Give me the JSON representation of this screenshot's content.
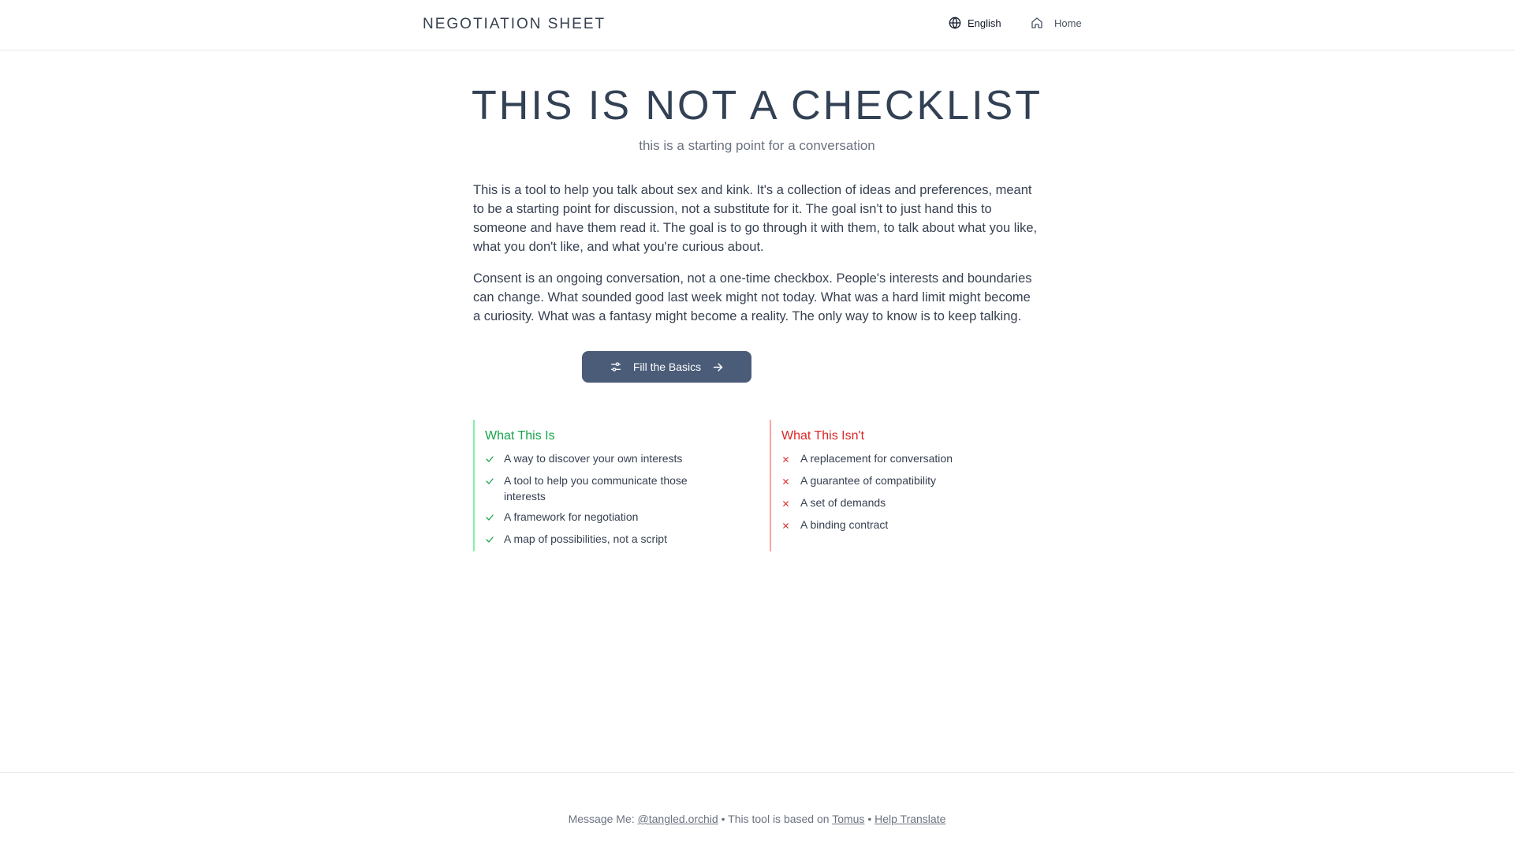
{
  "header": {
    "brand": "NEGOTIATION SHEET",
    "language_label": "English",
    "home_label": "Home"
  },
  "hero": {
    "title": "THIS IS NOT A CHECKLIST",
    "subtitle": "this is a starting point for a conversation"
  },
  "intro": {
    "paragraph_1": "This is a tool to help you talk about sex and kink. It's a collection of ideas and preferences, meant to be a starting point for discussion, not a substitute for it. The goal isn't to just hand this to someone and have them read it. The goal is to go through it with them, to talk about what you like, what you don't like, and what you're curious about.",
    "paragraph_2": "Consent is an ongoing conversation, not a one-time checkbox. People's interests and boundaries can change. What sounded good last week might not today. What was a hard limit might become a curiosity. What was a fantasy might become a reality. The only way to know is to keep talking."
  },
  "cta": {
    "label": "Fill the Basics",
    "left_icon": "sliders-icon",
    "right_icon": "arrow-right-icon"
  },
  "what_is": {
    "title": "What This Is",
    "items": [
      "A way to discover your own interests",
      "A tool to help you communicate those interests",
      "A framework for negotiation",
      "A map of possibilities, not a script"
    ]
  },
  "what_isnt": {
    "title": "What This Isn't",
    "items": [
      "A replacement for conversation",
      "A guarantee of compatibility",
      "A set of demands",
      "A binding contract"
    ]
  },
  "footer": {
    "message_prefix": "Message Me:",
    "handle": "@tangled.orchid",
    "separator_1": "•",
    "based_on_prefix": "This tool is based on",
    "based_on_link": "Tomus",
    "separator_2": "•",
    "translate_link": "Help Translate"
  },
  "colors": {
    "accent_button": "#4b5c78",
    "positive": "#16a34a",
    "negative": "#dc2626",
    "positive_border": "#86efac",
    "negative_border": "#fca5a5"
  }
}
